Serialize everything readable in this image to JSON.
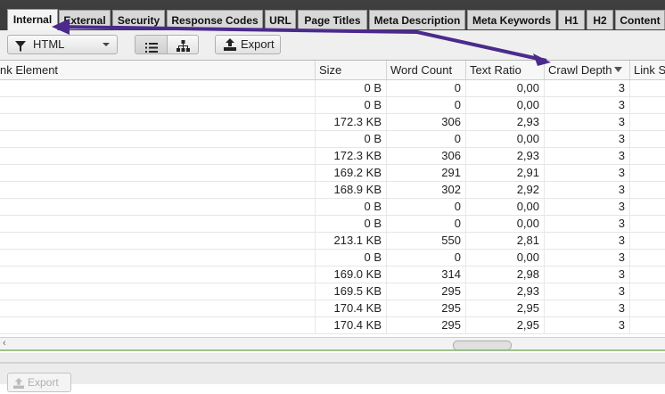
{
  "tabs": [
    {
      "label": "Internal"
    },
    {
      "label": "External"
    },
    {
      "label": "Security"
    },
    {
      "label": "Response Codes"
    },
    {
      "label": "URL"
    },
    {
      "label": "Page Titles"
    },
    {
      "label": "Meta Description"
    },
    {
      "label": "Meta Keywords"
    },
    {
      "label": "H1"
    },
    {
      "label": "H2"
    },
    {
      "label": "Content"
    }
  ],
  "toolbar": {
    "filter_label": "HTML",
    "export_label": "Export"
  },
  "columns": {
    "link_element": "nk Element",
    "size": "Size",
    "word_count": "Word Count",
    "text_ratio": "Text Ratio",
    "crawl_depth": "Crawl Depth",
    "link_score": "Link S"
  },
  "rows": [
    {
      "size": "0 B",
      "words": "0",
      "ratio": "0,00",
      "depth": "3"
    },
    {
      "size": "0 B",
      "words": "0",
      "ratio": "0,00",
      "depth": "3"
    },
    {
      "size": "172.3 KB",
      "words": "306",
      "ratio": "2,93",
      "depth": "3"
    },
    {
      "size": "0 B",
      "words": "0",
      "ratio": "0,00",
      "depth": "3"
    },
    {
      "size": "172.3 KB",
      "words": "306",
      "ratio": "2,93",
      "depth": "3"
    },
    {
      "size": "169.2 KB",
      "words": "291",
      "ratio": "2,91",
      "depth": "3"
    },
    {
      "size": "168.9 KB",
      "words": "302",
      "ratio": "2,92",
      "depth": "3"
    },
    {
      "size": "0 B",
      "words": "0",
      "ratio": "0,00",
      "depth": "3"
    },
    {
      "size": "0 B",
      "words": "0",
      "ratio": "0,00",
      "depth": "3"
    },
    {
      "size": "213.1 KB",
      "words": "550",
      "ratio": "2,81",
      "depth": "3"
    },
    {
      "size": "0 B",
      "words": "0",
      "ratio": "0,00",
      "depth": "3"
    },
    {
      "size": "169.0 KB",
      "words": "314",
      "ratio": "2,98",
      "depth": "3"
    },
    {
      "size": "169.5 KB",
      "words": "295",
      "ratio": "2,93",
      "depth": "3"
    },
    {
      "size": "170.4 KB",
      "words": "295",
      "ratio": "2,95",
      "depth": "3"
    },
    {
      "size": "170.4 KB",
      "words": "295",
      "ratio": "2,95",
      "depth": "3"
    }
  ],
  "bottom": {
    "export_label": "Export"
  },
  "colors": {
    "annotation_arrow": "#4b2a8c"
  }
}
